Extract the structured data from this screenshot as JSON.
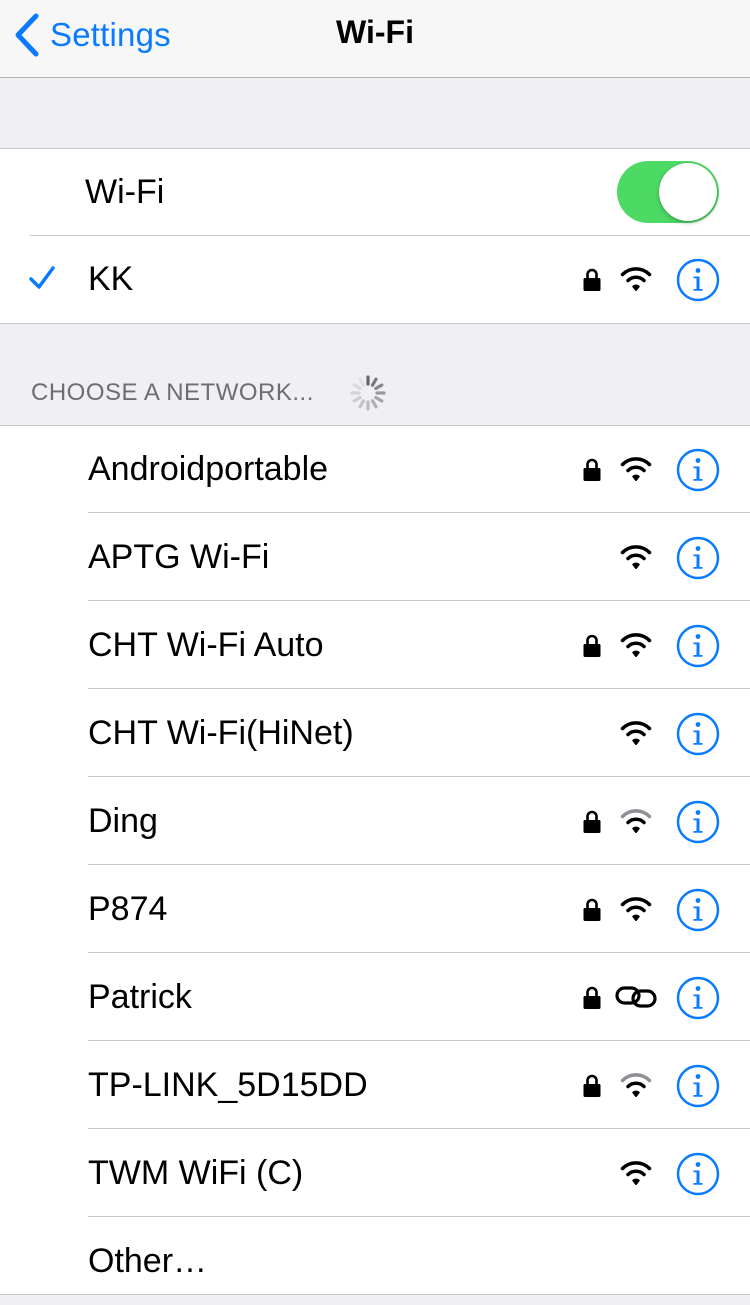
{
  "navbar": {
    "back_label": "Settings",
    "title": "Wi-Fi"
  },
  "wifi_toggle": {
    "label": "Wi-Fi",
    "on": true
  },
  "connected_network": {
    "name": "KK",
    "secured": true,
    "signal": "full",
    "selected": true
  },
  "choose_section": {
    "header": "CHOOSE A NETWORK...",
    "loading": true
  },
  "networks": [
    {
      "name": "Androidportable",
      "secured": true,
      "icon": "wifi-full-icon"
    },
    {
      "name": "APTG Wi-Fi",
      "secured": false,
      "icon": "wifi-full-icon"
    },
    {
      "name": "CHT Wi-Fi Auto",
      "secured": true,
      "icon": "wifi-full-icon"
    },
    {
      "name": "CHT Wi-Fi(HiNet)",
      "secured": false,
      "icon": "wifi-full-icon"
    },
    {
      "name": "Ding",
      "secured": true,
      "icon": "wifi-weak-icon"
    },
    {
      "name": "P874",
      "secured": true,
      "icon": "wifi-full-icon"
    },
    {
      "name": "Patrick",
      "secured": true,
      "icon": "personal-hotspot-link-icon"
    },
    {
      "name": "TP-LINK_5D15DD",
      "secured": true,
      "icon": "wifi-weak-icon"
    },
    {
      "name": "TWM WiFi (C)",
      "secured": false,
      "icon": "wifi-full-icon"
    }
  ],
  "other_label": "Other…",
  "colors": {
    "accent": "#0a7aff",
    "toggle_on": "#4cd964",
    "background": "#efeff4",
    "separator": "#c8c7cc",
    "section_header": "#6d6d72"
  }
}
